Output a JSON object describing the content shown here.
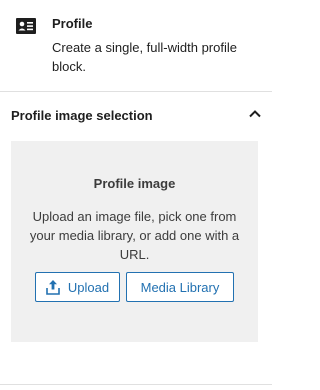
{
  "block": {
    "title": "Profile",
    "description": "Create a single, full-width profile block.",
    "icon": "profile-card-icon"
  },
  "section": {
    "title": "Profile image selection",
    "expanded": true,
    "chevron_icon": "chevron-up-icon"
  },
  "placeholder": {
    "title": "Profile image",
    "instructions": "Upload an image file, pick one from your media library, or add one with a URL.",
    "upload_label": "Upload",
    "upload_icon": "upload-icon",
    "media_library_label": "Media Library"
  },
  "colors": {
    "accent": "#2271b1",
    "placeholder_bg": "#f0f0f0",
    "divider": "#e0e0e0",
    "text": "#1e1e1e"
  }
}
